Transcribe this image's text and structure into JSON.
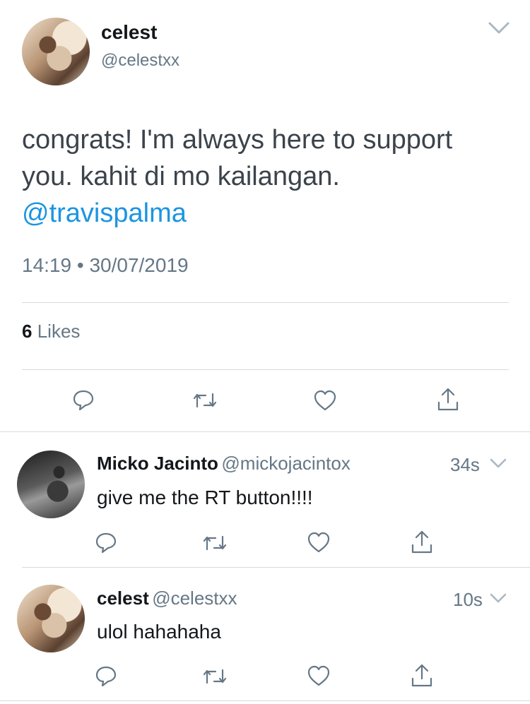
{
  "tweet": {
    "author_name": "celest",
    "author_handle": "@celestxx",
    "text_line1": "congrats! I'm always here to support",
    "text_line2": "you. kahit di mo kailangan.",
    "mention": "@travispalma",
    "time": "14:19",
    "separator": "•",
    "date": "30/07/2019",
    "likes_count": "6",
    "likes_label": "Likes"
  },
  "replies": [
    {
      "name": "Micko Jacinto",
      "handle": "@mickojacintox",
      "time": "34s",
      "text": "give me the RT button!!!!"
    },
    {
      "name": "celest",
      "handle": "@celestxx",
      "time": "10s",
      "text": "ulol hahahaha"
    }
  ],
  "colors": {
    "accent": "#1b95e0",
    "secondary_text": "#657786",
    "icon": "#657786",
    "divider": "#d6dbe0"
  },
  "icons": {
    "reply": "reply-icon",
    "retweet": "retweet-icon",
    "like": "heart-icon",
    "share": "share-icon",
    "menu": "chevron-down-icon"
  }
}
